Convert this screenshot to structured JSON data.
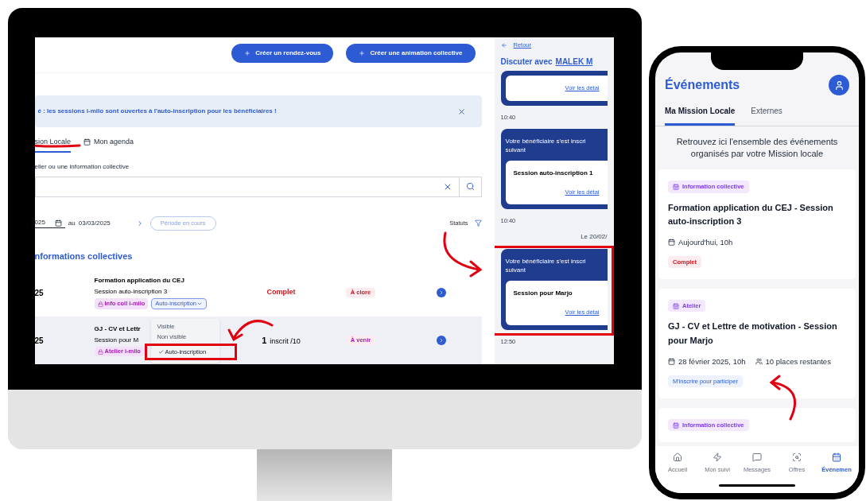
{
  "desktop": {
    "header_buttons": [
      "Créer un rendez-vous",
      "Créer une animation collective"
    ],
    "banner": "é : les sessions i-milo sont ouvertes à l'auto-inscription pour les bénéficiaires !",
    "tabs": [
      {
        "label": "sion Locale",
        "selected": true
      },
      {
        "label": "Mon agenda",
        "selected": false
      }
    ],
    "search_label": "elier ou une information collective",
    "filters": {
      "date_start": "025",
      "separator": "au",
      "date_end": "03/03/2025",
      "period_button": "Période en cours",
      "statuts": "Statuts"
    },
    "section_title": "nformations collectives",
    "rows": [
      {
        "date": "25",
        "title": "Formation application du CEJ",
        "subtitle": "Session auto-inscription 3",
        "tag": "Info coll i-milo",
        "visibility": "Auto-inscription",
        "kind": "full",
        "capacity": "Complet",
        "badge": "À clore",
        "color": "#c9191e",
        "highlighted": false
      },
      {
        "date": "25",
        "title": "GJ - CV et Lettr",
        "subtitle": "Session pour M",
        "tag": "Atelier i-milo",
        "kind": "count",
        "capacity": "1",
        "capacity_suffix": "inscrit /10",
        "badge": "À venir",
        "color": "#a21caf",
        "highlighted": true
      }
    ],
    "dropdown": [
      {
        "label": "Visible",
        "selected": false
      },
      {
        "label": "Non visible",
        "selected": false
      },
      {
        "label": "Auto-inscription",
        "selected": true
      }
    ]
  },
  "chat": {
    "back": "Retour",
    "title_prefix": "Discuter avec",
    "title_name": "MALEK M",
    "items": [
      {
        "kind": "card",
        "link": "Voir les détai"
      },
      {
        "kind": "time",
        "text": "10:40"
      },
      {
        "kind": "card",
        "text": "Votre bénéficiaire s'est inscri suivant",
        "session": "Session auto-inscription 1",
        "link": "Voir les détai"
      },
      {
        "kind": "time",
        "text": "10:40"
      },
      {
        "kind": "date",
        "text": "Le 20/02/"
      },
      {
        "kind": "card",
        "text": "Votre bénéficiaire s'est inscri suivant",
        "session": "Session pour Marjo",
        "link": "Voir les détai"
      },
      {
        "kind": "time",
        "text": "12:50"
      }
    ]
  },
  "phone": {
    "title": "Événements",
    "tabs": [
      {
        "label": "Ma Mission Locale",
        "selected": true
      },
      {
        "label": "Externes",
        "selected": false
      }
    ],
    "intro": "Retrouvez ici l'ensemble des événements organisés par votre Mission locale",
    "events": [
      {
        "type": "Information collective",
        "title": "Formation application du CEJ - Session auto-inscription 3",
        "date": "Aujourd'hui, 10h",
        "status": "Complet"
      },
      {
        "type": "Atelier",
        "title": "GJ - CV et Lettre de motivation - Session pour Marjo",
        "date": "28 février 2025, 10h",
        "places": "10 places restantes",
        "action": "M'inscrire pour participer"
      },
      {
        "type": "Information collective"
      }
    ],
    "nav": [
      {
        "label": "Accueil",
        "selected": false
      },
      {
        "label": "Mon suivi",
        "selected": false
      },
      {
        "label": "Messages",
        "selected": false
      },
      {
        "label": "Offres",
        "selected": false
      },
      {
        "label": "Événemen",
        "selected": true
      }
    ]
  }
}
